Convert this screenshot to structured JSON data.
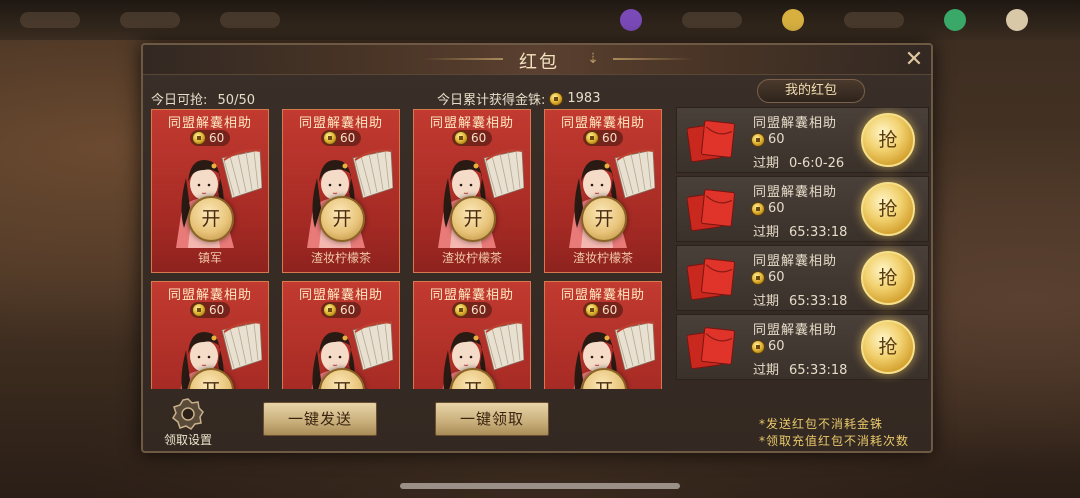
{
  "dialog": {
    "title": "红包",
    "today_grab_label": "今日可抢:",
    "today_grab_value": "50/50",
    "today_total_label": "今日累计获得金铢:",
    "today_total_value": "1983",
    "my_tab": "我的红包"
  },
  "cards": [
    {
      "title": "同盟解囊相助",
      "amount": "60",
      "open": "开",
      "sender": "镇军"
    },
    {
      "title": "同盟解囊相助",
      "amount": "60",
      "open": "开",
      "sender": "渣妆柠檬茶"
    },
    {
      "title": "同盟解囊相助",
      "amount": "60",
      "open": "开",
      "sender": "渣妆柠檬茶"
    },
    {
      "title": "同盟解囊相助",
      "amount": "60",
      "open": "开",
      "sender": "渣妆柠檬茶"
    },
    {
      "title": "同盟解囊相助",
      "amount": "60",
      "open": "开",
      "sender": ""
    },
    {
      "title": "同盟解囊相助",
      "amount": "60",
      "open": "开",
      "sender": ""
    },
    {
      "title": "同盟解囊相助",
      "amount": "60",
      "open": "开",
      "sender": ""
    },
    {
      "title": "同盟解囊相助",
      "amount": "60",
      "open": "开",
      "sender": ""
    }
  ],
  "my_list": [
    {
      "title": "同盟解囊相助",
      "amount": "60",
      "expire_label": "过期",
      "expire_time": "0-6:0-26",
      "grab": "抢"
    },
    {
      "title": "同盟解囊相助",
      "amount": "60",
      "expire_label": "过期",
      "expire_time": "65:33:18",
      "grab": "抢"
    },
    {
      "title": "同盟解囊相助",
      "amount": "60",
      "expire_label": "过期",
      "expire_time": "65:33:18",
      "grab": "抢"
    },
    {
      "title": "同盟解囊相助",
      "amount": "60",
      "expire_label": "过期",
      "expire_time": "65:33:18",
      "grab": "抢"
    }
  ],
  "bottom": {
    "settings_label": "领取设置",
    "send_all": "一键发送",
    "collect_all": "一键领取",
    "note1": "*发送红包不消耗金铢",
    "note2": "*领取充值红包不消耗次数"
  },
  "icons": [
    "down-arrow-icon",
    "close-icon",
    "coin-icon",
    "gear-icon",
    "envelope-icon"
  ],
  "colors": {
    "card_red": "#b0302a",
    "gold": "#e0b030",
    "panel": "#3a2f28",
    "note_yellow": "#e8c86a"
  }
}
